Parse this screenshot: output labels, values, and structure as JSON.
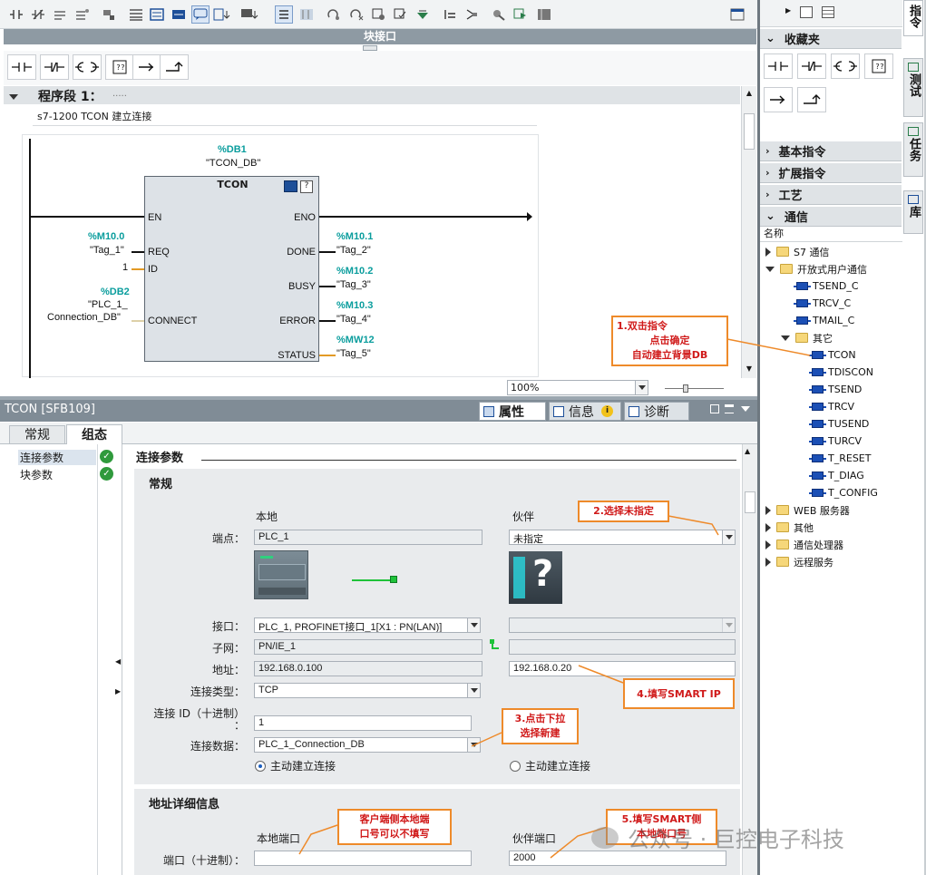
{
  "block_interface_label": "块接口",
  "network": {
    "title": "程序段 1：",
    "title_dots": ".....",
    "comment": "s7-1200  TCON 建立连接"
  },
  "fb": {
    "db_addr": "%DB1",
    "db_name": "\"TCON_DB\"",
    "block_name": "TCON",
    "pins_left": [
      "EN",
      "REQ",
      "ID",
      "CONNECT"
    ],
    "pins_right": [
      "ENO",
      "DONE",
      "BUSY",
      "ERROR",
      "STATUS"
    ],
    "req_addr": "%M10.0",
    "req_tag": "\"Tag_1\"",
    "id_value": "1",
    "conn_addr": "%DB2",
    "conn_tag1": "\"PLC_1_",
    "conn_tag2": "Connection_DB\"",
    "done_addr": "%M10.1",
    "done_tag": "\"Tag_2\"",
    "busy_addr": "%M10.2",
    "busy_tag": "\"Tag_3\"",
    "error_addr": "%M10.3",
    "error_tag": "\"Tag_4\"",
    "status_addr": "%MW12",
    "status_tag": "\"Tag_5\""
  },
  "zoom": "100%",
  "inspector": {
    "title": "TCON [SFB109]",
    "tabs_right": [
      "属性",
      "信息",
      "诊断"
    ],
    "tabs_left": [
      "常规",
      "组态"
    ],
    "nav": [
      "连接参数",
      "块参数"
    ],
    "section_title": "连接参数",
    "general": "常规",
    "local": "本地",
    "partner": "伙伴",
    "labels": {
      "endpoint": "端点：",
      "interface": "接口：",
      "subnet": "子网：",
      "address": "地址：",
      "conn_type": "连接类型：",
      "conn_id": "连接 ID（十进制）",
      "conn_id_colon": "：",
      "conn_data": "连接数据："
    },
    "endpoint_local": "PLC_1",
    "endpoint_partner": "未指定",
    "interface_local": "PLC_1, PROFINET接口_1[X1 : PN(LAN)]",
    "subnet_local": "PN/IE_1",
    "address_local": "192.168.0.100",
    "address_partner": "192.168.0.20",
    "conn_type": "TCP",
    "conn_id": "1",
    "conn_data": "PLC_1_Connection_DB",
    "active_local": "主动建立连接",
    "active_partner": "主动建立连接",
    "addr_detail": "地址详细信息",
    "local_port": "本地端口",
    "partner_port": "伙伴端口",
    "port_label": "端口（十进制）：",
    "port_local_value": "",
    "port_partner_value": "2000"
  },
  "right_panel": {
    "favorites": "收藏夹",
    "sections": [
      "基本指令",
      "扩展指令",
      "工艺",
      "通信"
    ],
    "name_col": "名称",
    "tree": {
      "s7": "S7 通信",
      "open": "开放式用户通信",
      "items1": [
        "TSEND_C",
        "TRCV_C",
        "TMAIL_C"
      ],
      "other": "其它",
      "items2": [
        "TCON",
        "TDISCON",
        "TSEND",
        "TRCV",
        "TUSEND",
        "TURCV",
        "T_RESET",
        "T_DIAG",
        "T_CONFIG"
      ],
      "after": [
        "WEB 服务器",
        "其他",
        "通信处理器",
        "远程服务"
      ]
    },
    "vtabs": [
      "指令",
      "测试",
      "任务",
      "库"
    ]
  },
  "callouts": {
    "c1_line1": "1.双击指令",
    "c1_line2": "点击确定",
    "c1_line3": "自动建立背景DB",
    "c2": "2.选择未指定",
    "c3_line1": "3.点击下拉",
    "c3_line2": "选择新建",
    "c4": "4.填写SMART IP",
    "c5_line1": "5.填写SMART侧",
    "c5_line2": "本地端口号",
    "c6_line1": "客户端侧本地端",
    "c6_line2": "口号可以不填写"
  },
  "watermark": "公众号 · 巨控电子科技"
}
